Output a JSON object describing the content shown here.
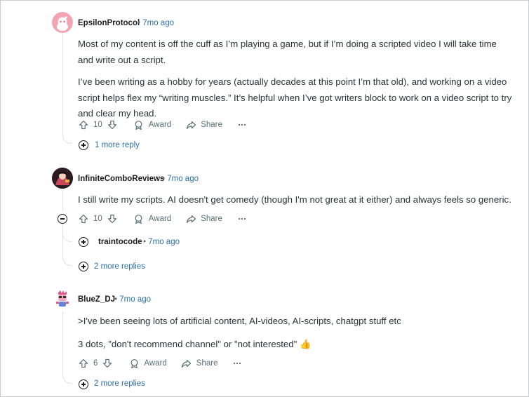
{
  "comments": [
    {
      "author": "EpsilonProtocol",
      "time": "7mo ago",
      "paragraphs": [
        "Most of my content is off the cuff as I’m playing a game, but if I’m doing a scripted video I will take time and write out a script.",
        "I’ve been writing as a hobby for years (actually decades at this point I’m that old), and working on a video script helps flex my “writing muscles.” It’s helpful when I’ve got writers block to work on a video script to try and clear my head."
      ],
      "votes": "10",
      "award_label": "Award",
      "share_label": "Share",
      "more_label": "1 more reply"
    },
    {
      "author": "InfiniteComboReviews",
      "time": "7mo ago",
      "paragraphs": [
        "I still write my scripts. AI doesn't get comedy (though I'm not great at it either) and always feels so generic."
      ],
      "votes": "10",
      "award_label": "Award",
      "share_label": "Share",
      "reply_author": "traintocode",
      "reply_time": "7mo ago",
      "more_label": "2 more replies"
    },
    {
      "author": "BlueZ_DJ",
      "time": "7mo ago",
      "paragraphs": [
        ">I've been seeing lots of artificial content, AI-videos, AI-scripts, chatgpt stuff etc",
        "3 dots, \"don't recommend channel\" or \"not interested\" 👍"
      ],
      "votes": "6",
      "award_label": "Award",
      "share_label": "Share",
      "more_label": "2 more replies"
    }
  ],
  "separator": "•",
  "icons": {
    "upvote": "upvote-icon",
    "downvote": "downvote-icon",
    "award": "award-icon",
    "share": "share-icon",
    "overflow": "more-options-icon",
    "expand": "expand-icon",
    "collapse": "collapse-icon"
  }
}
